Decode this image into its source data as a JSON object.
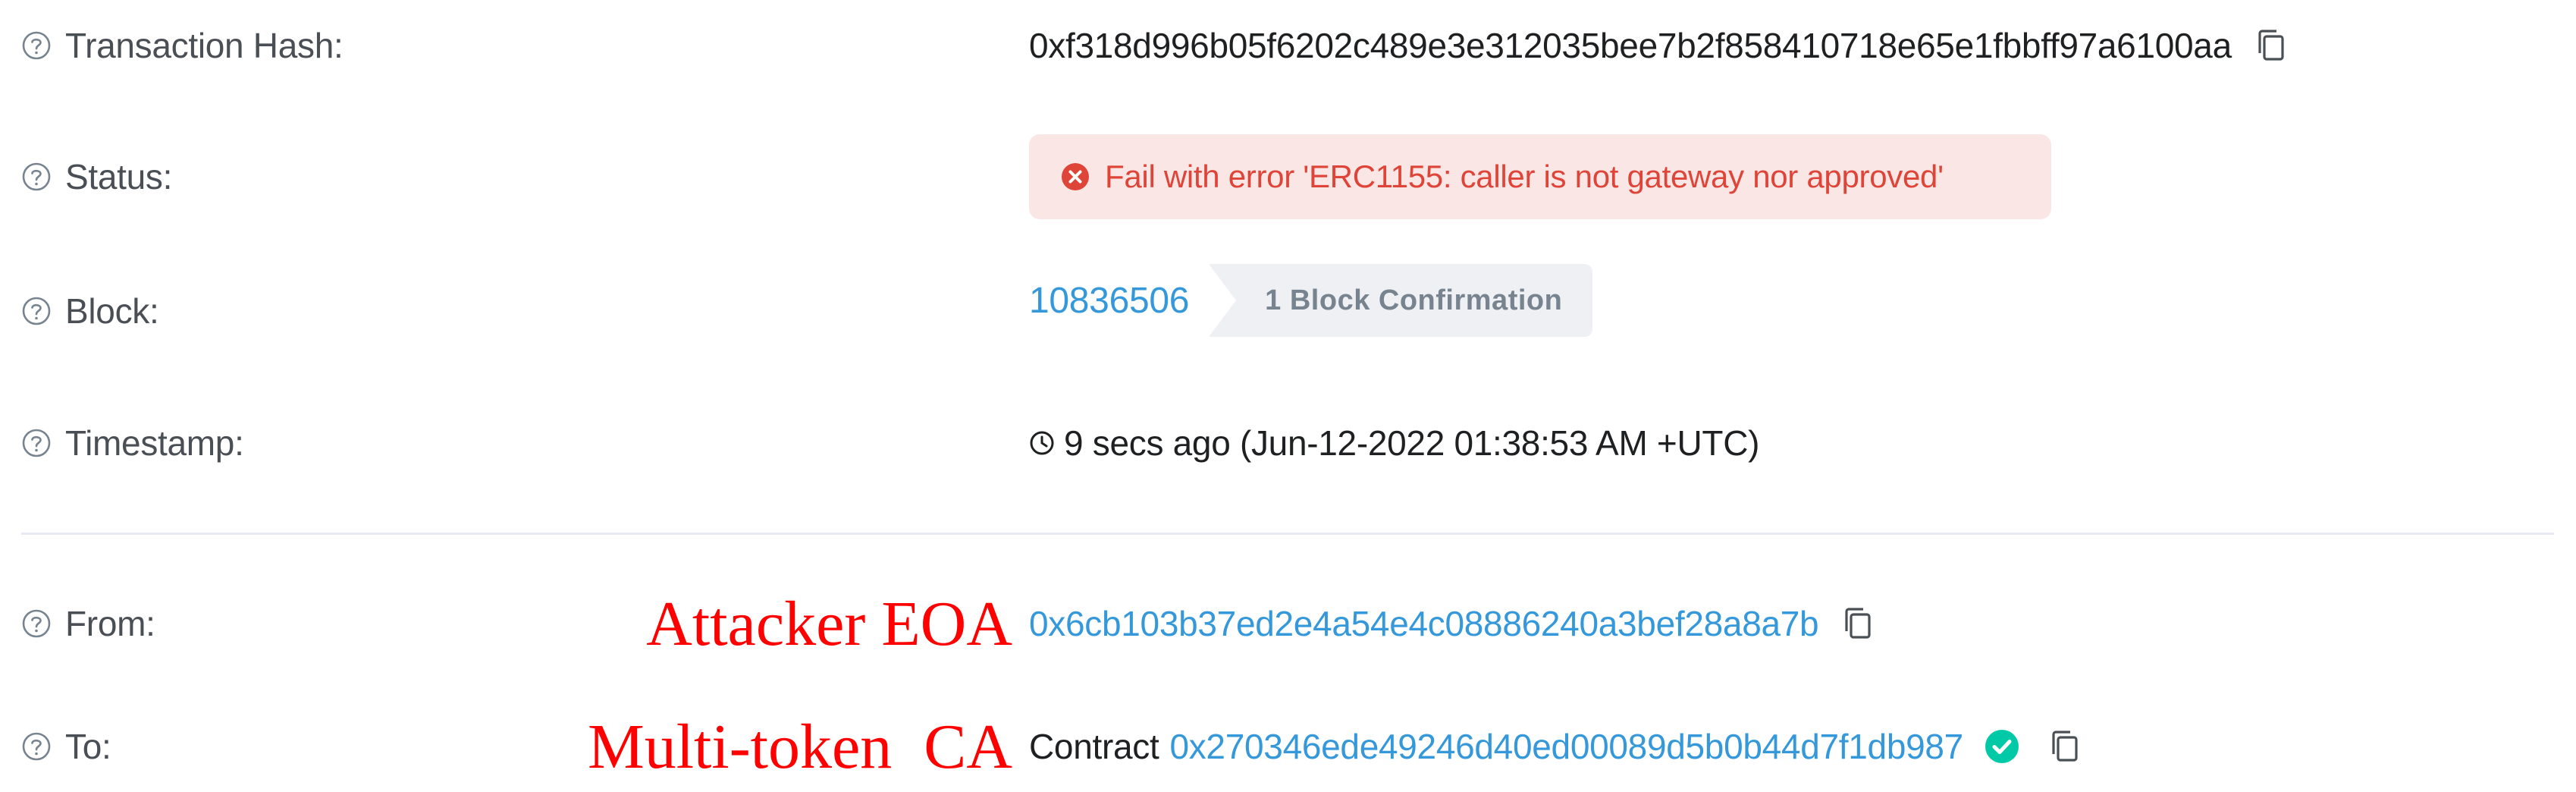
{
  "rows": {
    "tx_hash": {
      "label": "Transaction Hash:",
      "value": "0xf318d996b05f6202c489e3e312035bee7b2f858410718e65e1fbbff97a6100aa"
    },
    "status": {
      "label": "Status:",
      "message": "Fail with error 'ERC1155: caller is not gateway nor approved'"
    },
    "block": {
      "label": "Block:",
      "number": "10836506",
      "confirmations": "1 Block Confirmation"
    },
    "timestamp": {
      "label": "Timestamp:",
      "value": "9 secs ago (Jun-12-2022 01:38:53 AM +UTC)"
    },
    "from": {
      "label": "From:",
      "annotation": "Attacker EOA",
      "address": "0x6cb103b37ed2e4a54e4c08886240a3bef28a8a7b"
    },
    "to": {
      "label": "To:",
      "annotation": "Multi-token  CA",
      "prefix": "Contract",
      "address": "0x270346ede49246d40ed00089d5b0b44d7f1db987"
    }
  },
  "icons": {
    "help": "question-circle-icon",
    "copy": "copy-icon",
    "error": "x-circle-icon",
    "clock": "clock-icon",
    "verified": "check-circle-icon"
  },
  "colors": {
    "link": "#3498db",
    "error_text": "#de4437",
    "error_bg": "#fbe6e6",
    "verified": "#00c9a7",
    "annotation": "#ff0000"
  }
}
